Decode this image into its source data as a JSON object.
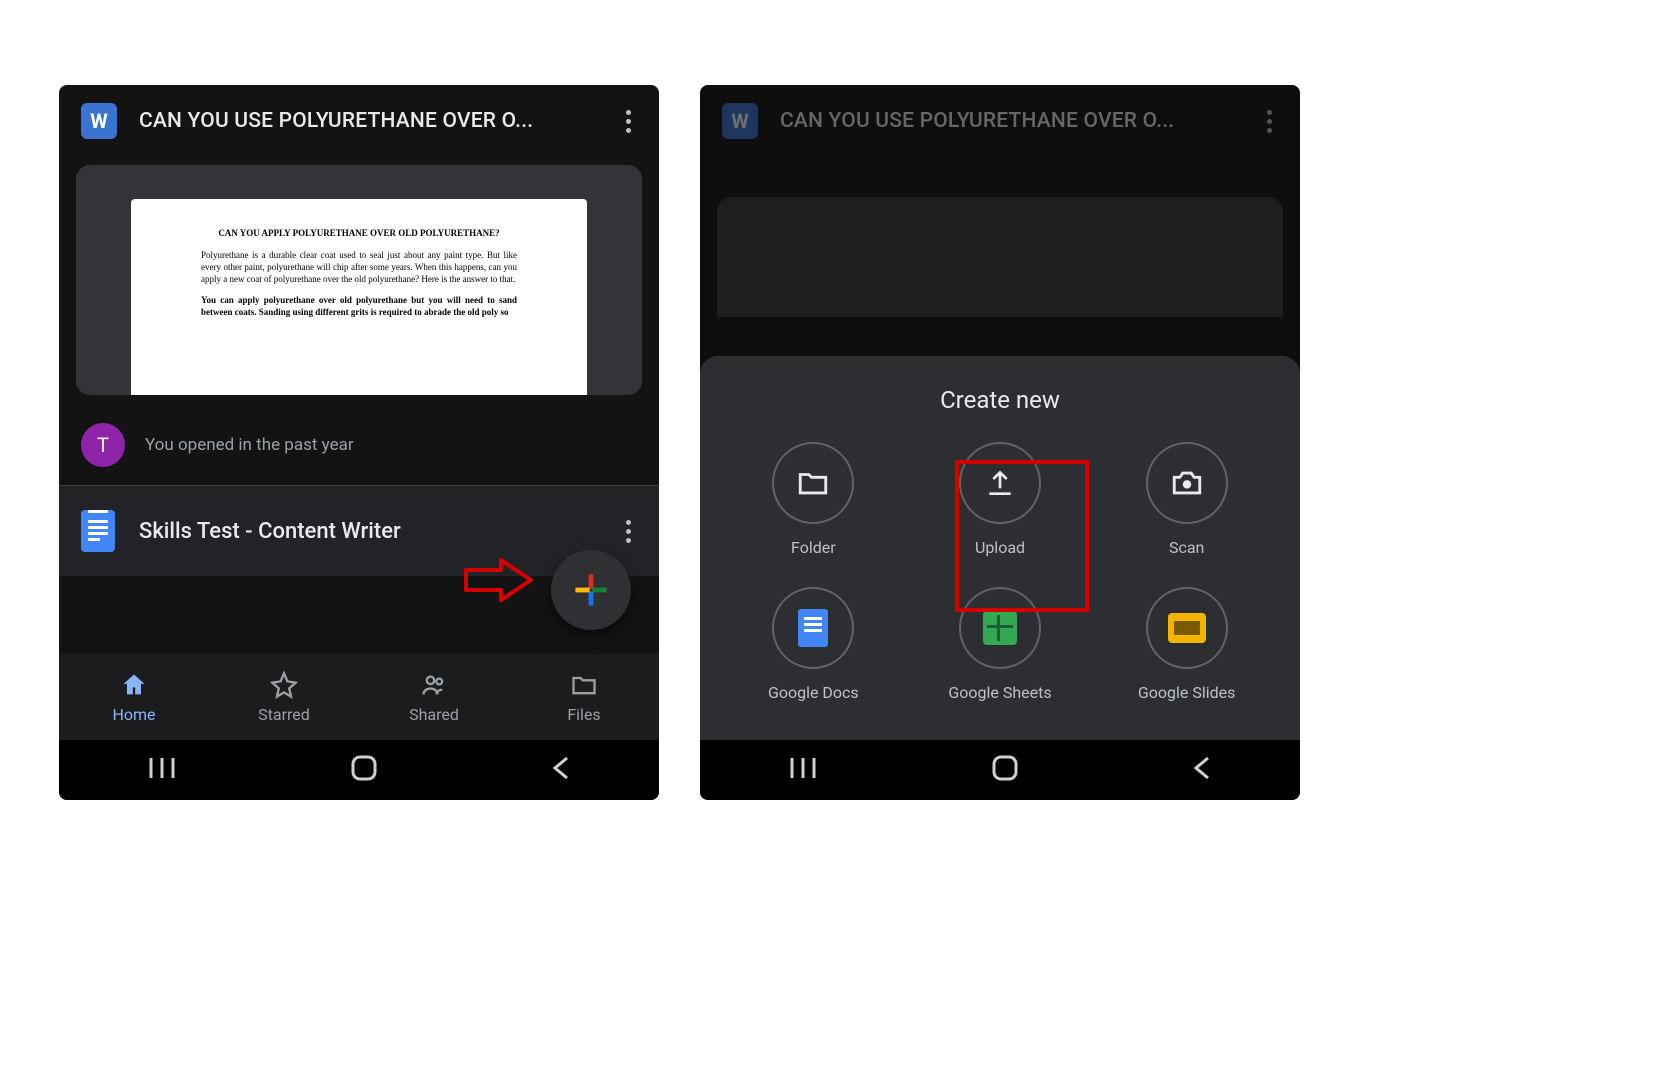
{
  "left": {
    "header": {
      "title": "CAN YOU USE POLYURETHANE OVER O...",
      "badge": "W"
    },
    "preview": {
      "heading": "CAN YOU APPLY POLYURETHANE OVER OLD POLYURETHANE?",
      "p1": "Polyurethane is a durable clear coat used to seal just about any paint type. But like every other paint, polyurethane will chip after some years. When this happens, can you apply a new coat of polyurethane over the old polyurethane? Here is the answer to that.",
      "p2": "You can apply polyurethane over old polyurethane but you will need to sand between coats. Sanding using different grits is required to abrade the old poly so"
    },
    "avatar": {
      "initial": "T",
      "caption": "You opened in the past year"
    },
    "second_file": {
      "title": "Skills Test - Content Writer"
    },
    "nav": {
      "home": "Home",
      "starred": "Starred",
      "shared": "Shared",
      "files": "Files"
    }
  },
  "right": {
    "header": {
      "title": "CAN YOU USE POLYURETHANE OVER O...",
      "badge": "W"
    },
    "sheet": {
      "title": "Create new",
      "items": {
        "folder": "Folder",
        "upload": "Upload",
        "scan": "Scan",
        "docs": "Google Docs",
        "sheets": "Google Sheets",
        "slides": "Google Slides"
      }
    }
  }
}
